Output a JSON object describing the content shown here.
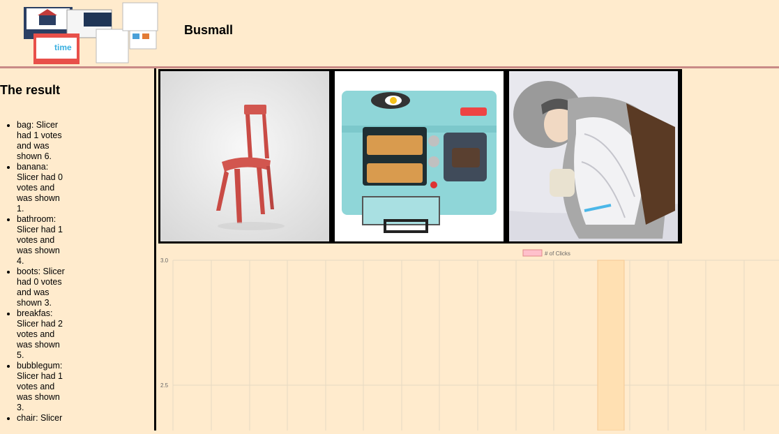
{
  "header": {
    "brand": "Busmall"
  },
  "sidebar": {
    "title": "The result",
    "items": [
      "bag: Slicer had 1 votes and was shown 6.",
      "banana: Slicer had 0 votes and was shown 1.",
      "bathroom: Slicer had 1 votes and was shown 4.",
      "boots: Slicer had 0 votes and was shown 3.",
      "breakfas: Slicer had 2 votes and was shown 5.",
      "bubblegum: Slicer had 1 votes and was shown 3.",
      "chair: Slicer"
    ]
  },
  "products": [
    {
      "name": "chair-icon"
    },
    {
      "name": "breakfast-icon"
    },
    {
      "name": "tauntaun-icon"
    }
  ],
  "colors": {
    "bg": "#ffebcd",
    "border": "#000000",
    "accent": "#c98a86",
    "legend": "#ffc0cb",
    "bar": "#ffe0b2"
  },
  "chart_data": {
    "type": "bar",
    "legend": "# of Clicks",
    "y_ticks": [
      "3.0",
      "2.5"
    ],
    "ylim_visible": [
      2.5,
      3.0
    ]
  }
}
